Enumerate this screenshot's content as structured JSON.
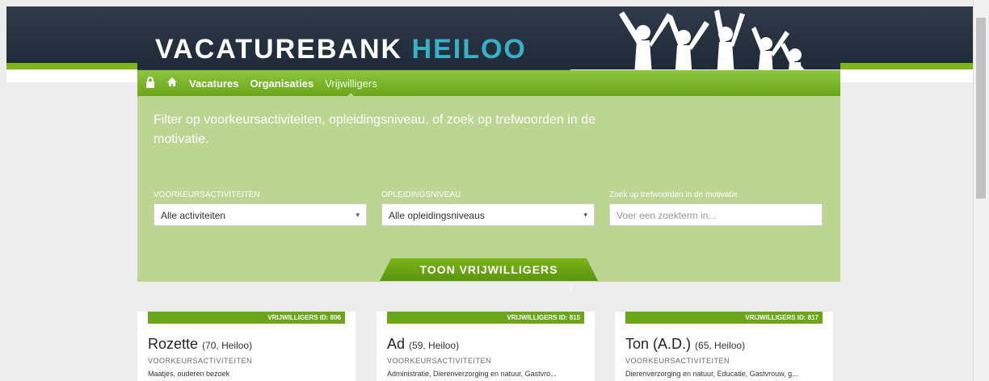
{
  "header": {
    "logo_main": "VACATUREBANK",
    "logo_accent": "HEILOO"
  },
  "nav": {
    "icons": [
      "lock-icon",
      "home-icon"
    ],
    "items": [
      {
        "label": "Vacatures",
        "active": false
      },
      {
        "label": "Organisaties",
        "active": false
      },
      {
        "label": "Vrijwilligers",
        "active": true
      }
    ]
  },
  "filters": {
    "intro": "Filter op voorkeursactiviteiten, opleidingsniveau, of zoek op trefwoorden in de motivatie.",
    "activities": {
      "label": "VOORKEURSACTIVITEITEN",
      "value": "Alle activiteiten"
    },
    "education": {
      "label": "OPLEIDINGSNIVEAU",
      "value": "Alle opleidingsniveaus"
    },
    "search": {
      "label": "Zoek op trefwoorden in de motivatie",
      "placeholder": "Voer een zoekterm in..."
    },
    "submit_label": "TOON VRIJWILLIGERS"
  },
  "cards": [
    {
      "id_label": "VRIJWILLIGERS ID: 806",
      "name": "Rozette",
      "meta": "(70, Heiloo)",
      "field_label": "VOORKEURSACTIVITEITEN",
      "field_value": "Maatjes, ouderen bezoek"
    },
    {
      "id_label": "VRIJWILLIGERS ID: 815",
      "name": "Ad",
      "meta": "(59, Heiloo)",
      "field_label": "VOORKEURSACTIVITEITEN",
      "field_value": "Administratie, Dierenverzorging en natuur, Gastvro..."
    },
    {
      "id_label": "VRIJWILLIGERS ID: 817",
      "name": "Ton (A.D.)",
      "meta": "(65, Heiloo)",
      "field_label": "VOORKEURSACTIVITEITEN",
      "field_value": "Dierenverzorging en natuur, Educatie, Gastvrouw, g..."
    }
  ],
  "colors": {
    "brand_green": "#7cb518",
    "header_navy": "#2f3a4a",
    "hero_green": "#bcd592",
    "accent_teal": "#3ab0c8"
  }
}
